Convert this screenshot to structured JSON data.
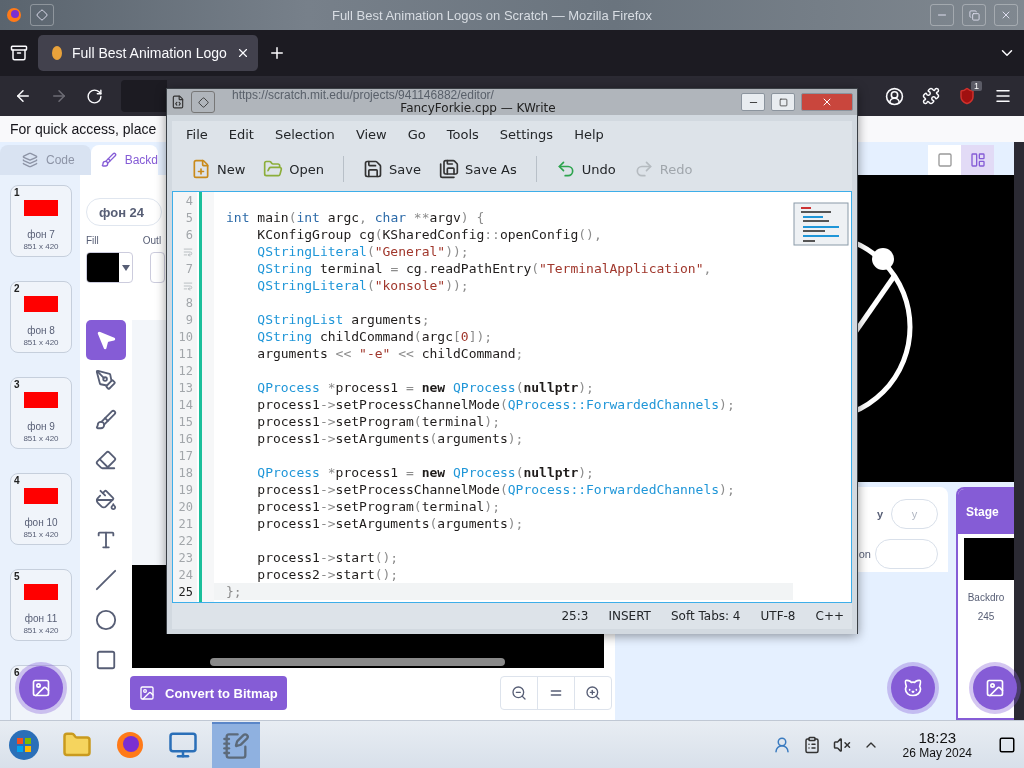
{
  "firefox": {
    "title": "Full Best Animation Logos on Scratch — Mozilla Firefox",
    "tabs": [
      {
        "label": "Full Best Animation Logo",
        "selected": true
      }
    ],
    "url": "https://scratch.mit.edu/projects/941146882/editor/",
    "extension_badge": "1",
    "bookmarks_hint": "For quick access, place"
  },
  "scratch": {
    "tabs": [
      {
        "kind": "code",
        "label": "Code",
        "selected": false
      },
      {
        "kind": "backdrops",
        "label": "Backd",
        "selected": true
      }
    ],
    "costumes": [
      {
        "number": "1",
        "name": "фон 7",
        "size": "851 x 420"
      },
      {
        "number": "2",
        "name": "фон 8",
        "size": "851 x 420"
      },
      {
        "number": "3",
        "name": "фон 9",
        "size": "851 x 420"
      },
      {
        "number": "4",
        "name": "фон 10",
        "size": "851 x 420"
      },
      {
        "number": "5",
        "name": "фон 11",
        "size": "851 x 420"
      },
      {
        "number": "6"
      }
    ],
    "costume_name": "фон 24",
    "fill_label": "Fill",
    "outline_label": "Outl",
    "tools": [
      {
        "kind": "select",
        "selected": true
      },
      {
        "kind": "reshape",
        "selected": false
      },
      {
        "kind": "brush",
        "selected": false
      },
      {
        "kind": "eraser",
        "selected": false
      },
      {
        "kind": "fill",
        "selected": false
      },
      {
        "kind": "text",
        "selected": false
      },
      {
        "kind": "line",
        "selected": false
      },
      {
        "kind": "circle",
        "selected": false
      },
      {
        "kind": "rect",
        "selected": false
      }
    ],
    "convert_button": "Convert to Bitmap",
    "sprite_info": {
      "y_label": "y",
      "y_placeholder": "y",
      "direction_label": "on"
    },
    "stage_panel": {
      "title": "Stage",
      "backdrops_label": "Backdro",
      "backdrop_count": "245"
    }
  },
  "kwrite": {
    "title": "FancyForkie.cpp — KWrite",
    "menu": [
      "File",
      "Edit",
      "Selection",
      "View",
      "Go",
      "Tools",
      "Settings",
      "Help"
    ],
    "toolbar_groups": [
      {
        "buttons": [
          {
            "kind": "new",
            "label": "New",
            "disabled": false
          },
          {
            "kind": "open",
            "label": "Open",
            "disabled": false
          }
        ]
      },
      {
        "buttons": [
          {
            "kind": "save",
            "label": "Save",
            "disabled": false
          },
          {
            "kind": "saveas",
            "label": "Save As",
            "disabled": false
          }
        ]
      },
      {
        "buttons": [
          {
            "kind": "undo",
            "label": "Undo",
            "disabled": false
          },
          {
            "kind": "redo",
            "label": "Redo",
            "disabled": true
          }
        ]
      }
    ],
    "lines": [
      {
        "kind": "line",
        "number": "4",
        "current": false
      },
      {
        "kind": "line",
        "number": "5",
        "current": false,
        "tokens": [
          {
            "kind": "kw",
            "t": "int"
          },
          {
            "kind": "pl",
            "t": " main"
          },
          {
            "kind": "op",
            "t": "("
          },
          {
            "kind": "kw",
            "t": "int"
          },
          {
            "kind": "pl",
            "t": " argc"
          },
          {
            "kind": "op",
            "t": ", "
          },
          {
            "kind": "kw",
            "t": "char"
          },
          {
            "kind": "op",
            "t": " **"
          },
          {
            "kind": "pl",
            "t": "argv"
          },
          {
            "kind": "op",
            "t": ") {"
          }
        ]
      },
      {
        "kind": "line",
        "number": "6",
        "current": false,
        "tokens": [
          {
            "kind": "pl",
            "t": "    KConfigGroup cg"
          },
          {
            "kind": "op",
            "t": "("
          },
          {
            "kind": "pl",
            "t": "KSharedConfig"
          },
          {
            "kind": "op",
            "t": "::"
          },
          {
            "kind": "pl",
            "t": "openConfig"
          },
          {
            "kind": "op",
            "t": "(),"
          }
        ]
      },
      {
        "kind": "wrap",
        "current": false,
        "tokens": [
          {
            "kind": "type",
            "t": "    QStringLiteral"
          },
          {
            "kind": "op",
            "t": "("
          },
          {
            "kind": "str",
            "t": "\"General\""
          },
          {
            "kind": "op",
            "t": "));"
          }
        ]
      },
      {
        "kind": "line",
        "number": "7",
        "current": false,
        "tokens": [
          {
            "kind": "type",
            "t": "    QString"
          },
          {
            "kind": "pl",
            "t": " terminal "
          },
          {
            "kind": "op",
            "t": "="
          },
          {
            "kind": "pl",
            "t": " cg"
          },
          {
            "kind": "op",
            "t": "."
          },
          {
            "kind": "pl",
            "t": "readPathEntry"
          },
          {
            "kind": "op",
            "t": "("
          },
          {
            "kind": "str",
            "t": "\"TerminalApplication\""
          },
          {
            "kind": "op",
            "t": ","
          }
        ]
      },
      {
        "kind": "wrap",
        "current": false,
        "tokens": [
          {
            "kind": "type",
            "t": "    QStringLiteral"
          },
          {
            "kind": "op",
            "t": "("
          },
          {
            "kind": "str",
            "t": "\"konsole\""
          },
          {
            "kind": "op",
            "t": "));"
          }
        ]
      },
      {
        "kind": "line",
        "number": "8",
        "current": false
      },
      {
        "kind": "line",
        "number": "9",
        "current": false,
        "tokens": [
          {
            "kind": "type",
            "t": "    QStringList"
          },
          {
            "kind": "pl",
            "t": " arguments"
          },
          {
            "kind": "op",
            "t": ";"
          }
        ]
      },
      {
        "kind": "line",
        "number": "10",
        "current": false,
        "tokens": [
          {
            "kind": "type",
            "t": "    QString"
          },
          {
            "kind": "pl",
            "t": " childCommand"
          },
          {
            "kind": "op",
            "t": "("
          },
          {
            "kind": "pl",
            "t": "argc"
          },
          {
            "kind": "op",
            "t": "["
          },
          {
            "kind": "str",
            "t": "0"
          },
          {
            "kind": "op",
            "t": "]);"
          }
        ]
      },
      {
        "kind": "line",
        "number": "11",
        "current": false,
        "tokens": [
          {
            "kind": "pl",
            "t": "    arguments "
          },
          {
            "kind": "op",
            "t": "<< "
          },
          {
            "kind": "str",
            "t": "\"-e\""
          },
          {
            "kind": "op",
            "t": " << "
          },
          {
            "kind": "pl",
            "t": "childCommand"
          },
          {
            "kind": "op",
            "t": ";"
          }
        ]
      },
      {
        "kind": "line",
        "number": "12",
        "current": false
      },
      {
        "kind": "line",
        "number": "13",
        "current": false,
        "tokens": [
          {
            "kind": "type",
            "t": "    QProcess"
          },
          {
            "kind": "op",
            "t": " *"
          },
          {
            "kind": "pl",
            "t": "process1 "
          },
          {
            "kind": "op",
            "t": "= "
          },
          {
            "kind": "bold",
            "t": "new"
          },
          {
            "kind": "type",
            "t": " QProcess"
          },
          {
            "kind": "op",
            "t": "("
          },
          {
            "kind": "bold",
            "t": "nullptr"
          },
          {
            "kind": "op",
            "t": ");"
          }
        ]
      },
      {
        "kind": "line",
        "number": "14",
        "current": false,
        "tokens": [
          {
            "kind": "pl",
            "t": "    process1"
          },
          {
            "kind": "op",
            "t": "->"
          },
          {
            "kind": "pl",
            "t": "setProcessChannelMode"
          },
          {
            "kind": "op",
            "t": "("
          },
          {
            "kind": "type",
            "t": "QProcess::ForwardedChannels"
          },
          {
            "kind": "op",
            "t": ");"
          }
        ]
      },
      {
        "kind": "line",
        "number": "15",
        "current": false,
        "tokens": [
          {
            "kind": "pl",
            "t": "    process1"
          },
          {
            "kind": "op",
            "t": "->"
          },
          {
            "kind": "pl",
            "t": "setProgram"
          },
          {
            "kind": "op",
            "t": "("
          },
          {
            "kind": "pl",
            "t": "terminal"
          },
          {
            "kind": "op",
            "t": ");"
          }
        ]
      },
      {
        "kind": "line",
        "number": "16",
        "current": false,
        "tokens": [
          {
            "kind": "pl",
            "t": "    process1"
          },
          {
            "kind": "op",
            "t": "->"
          },
          {
            "kind": "pl",
            "t": "setArguments"
          },
          {
            "kind": "op",
            "t": "("
          },
          {
            "kind": "pl",
            "t": "arguments"
          },
          {
            "kind": "op",
            "t": ");"
          }
        ]
      },
      {
        "kind": "line",
        "number": "17",
        "current": false
      },
      {
        "kind": "line",
        "number": "18",
        "current": false,
        "tokens": [
          {
            "kind": "type",
            "t": "    QProcess"
          },
          {
            "kind": "op",
            "t": " *"
          },
          {
            "kind": "pl",
            "t": "process1 "
          },
          {
            "kind": "op",
            "t": "= "
          },
          {
            "kind": "bold",
            "t": "new"
          },
          {
            "kind": "type",
            "t": " QProcess"
          },
          {
            "kind": "op",
            "t": "("
          },
          {
            "kind": "bold",
            "t": "nullptr"
          },
          {
            "kind": "op",
            "t": ");"
          }
        ]
      },
      {
        "kind": "line",
        "number": "19",
        "current": false,
        "tokens": [
          {
            "kind": "pl",
            "t": "    process1"
          },
          {
            "kind": "op",
            "t": "->"
          },
          {
            "kind": "pl",
            "t": "setProcessChannelMode"
          },
          {
            "kind": "op",
            "t": "("
          },
          {
            "kind": "type",
            "t": "QProcess::ForwardedChannels"
          },
          {
            "kind": "op",
            "t": ");"
          }
        ]
      },
      {
        "kind": "line",
        "number": "20",
        "current": false,
        "tokens": [
          {
            "kind": "pl",
            "t": "    process1"
          },
          {
            "kind": "op",
            "t": "->"
          },
          {
            "kind": "pl",
            "t": "setProgram"
          },
          {
            "kind": "op",
            "t": "("
          },
          {
            "kind": "pl",
            "t": "terminal"
          },
          {
            "kind": "op",
            "t": ");"
          }
        ]
      },
      {
        "kind": "line",
        "number": "21",
        "current": false,
        "tokens": [
          {
            "kind": "pl",
            "t": "    process1"
          },
          {
            "kind": "op",
            "t": "->"
          },
          {
            "kind": "pl",
            "t": "setArguments"
          },
          {
            "kind": "op",
            "t": "("
          },
          {
            "kind": "pl",
            "t": "arguments"
          },
          {
            "kind": "op",
            "t": ");"
          }
        ]
      },
      {
        "kind": "line",
        "number": "22",
        "current": false
      },
      {
        "kind": "line",
        "number": "23",
        "current": false,
        "tokens": [
          {
            "kind": "pl",
            "t": "    process1"
          },
          {
            "kind": "op",
            "t": "->"
          },
          {
            "kind": "pl",
            "t": "start"
          },
          {
            "kind": "op",
            "t": "();"
          }
        ]
      },
      {
        "kind": "line",
        "number": "24",
        "current": false,
        "tokens": [
          {
            "kind": "pl",
            "t": "    process2"
          },
          {
            "kind": "op",
            "t": "->"
          },
          {
            "kind": "pl",
            "t": "start"
          },
          {
            "kind": "op",
            "t": "();"
          }
        ]
      },
      {
        "kind": "line",
        "number": "25",
        "current": true,
        "tokens": [
          {
            "kind": "op",
            "t": "};"
          }
        ]
      }
    ],
    "status": [
      "25:3",
      "INSERT",
      "Soft Tabs: 4",
      "UTF-8",
      "C++"
    ]
  },
  "taskbar": {
    "apps": [
      {
        "kind": "explorer",
        "selected": false
      },
      {
        "kind": "browser",
        "selected": false
      },
      {
        "kind": "monitor",
        "selected": false
      },
      {
        "kind": "notepad",
        "selected": true
      }
    ],
    "time": "18:23",
    "date": "26 May 2024"
  }
}
